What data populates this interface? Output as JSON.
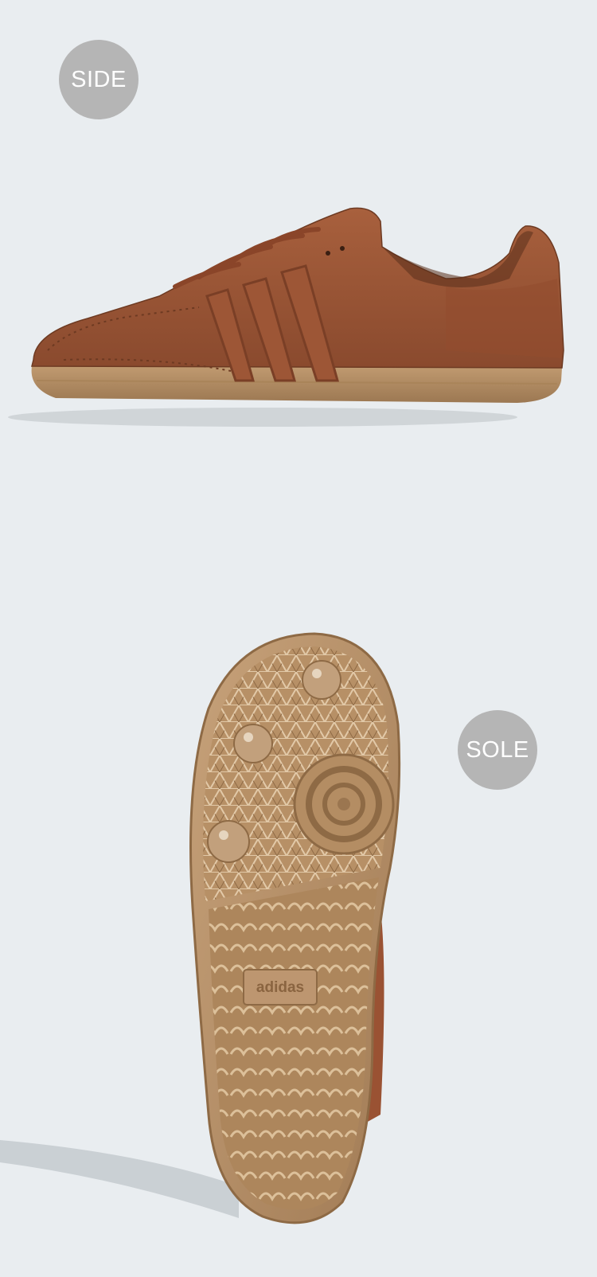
{
  "views": {
    "side": {
      "label": "SIDE"
    },
    "sole": {
      "label": "SOLE"
    }
  },
  "product": {
    "sole_brand_text": "adidas",
    "colors": {
      "background": "#e9edf0",
      "upper_leather": "#9a5233",
      "upper_shadow": "#7a3f26",
      "gum_sole": "#b08a62",
      "badge": "#b5b5b5"
    }
  }
}
